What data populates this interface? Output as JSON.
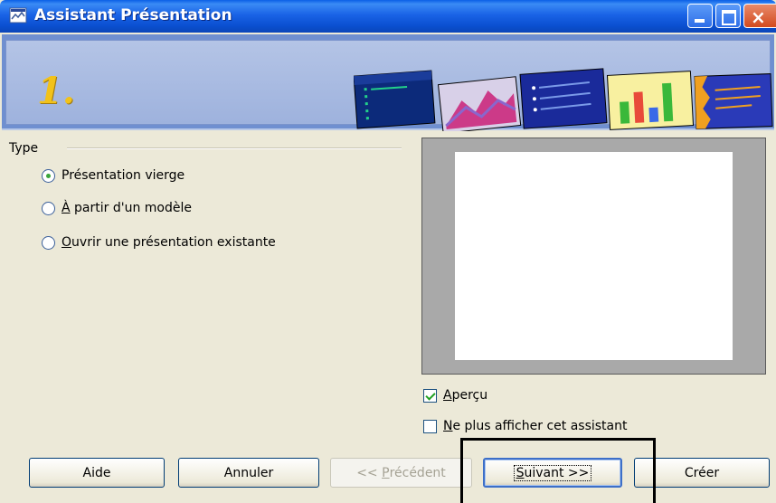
{
  "window": {
    "title": "Assistant Présentation"
  },
  "banner": {
    "step": "1."
  },
  "type_group": {
    "label": "Type",
    "options": [
      {
        "label": "Présentation vierge",
        "underline": "",
        "rest": "Présentation vierge",
        "checked": true
      },
      {
        "label": "À partir d'un modèle",
        "underline": "À",
        "rest": " partir d'un modèle",
        "checked": false
      },
      {
        "label": "Ouvrir une présentation existante",
        "underline": "O",
        "rest": "uvrir une présentation existante",
        "checked": false
      }
    ]
  },
  "preview": {
    "checkbox_label": "Aperçu",
    "checkbox_u": "A",
    "checkbox_rest": "perçu",
    "checked": true
  },
  "no_show": {
    "label": "Ne plus afficher cet assistant",
    "u": "N",
    "rest": "e plus afficher cet assistant",
    "checked": false
  },
  "buttons": {
    "help": "Aide",
    "cancel": "Annuler",
    "prev_pre": "<< ",
    "prev_u": "P",
    "prev_rest": "récédent",
    "next_u": "S",
    "next_rest": "uivant >>",
    "create": "Créer"
  },
  "colors": {
    "titlebar": "#0a5fe6",
    "face": "#ece9d8",
    "step_number": "#f2c21a"
  },
  "icons": [
    "app-icon",
    "minimize-icon",
    "maximize-icon",
    "close-icon"
  ]
}
